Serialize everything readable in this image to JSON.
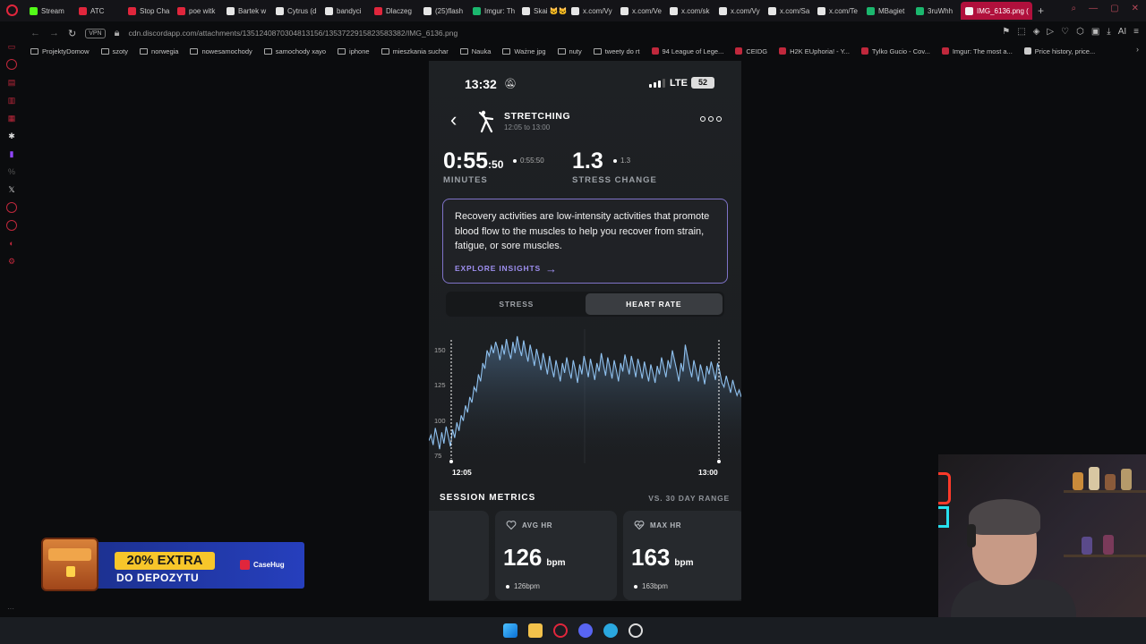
{
  "browser": {
    "tabs": [
      {
        "label": "Stream",
        "color": "#53fc18"
      },
      {
        "label": "ATC",
        "color": "#e0263c"
      },
      {
        "label": "Stop Cha",
        "color": "#e0263c"
      },
      {
        "label": "poe witk",
        "color": "#e0263c"
      },
      {
        "label": "Bartek w",
        "color": "#e6e6e6"
      },
      {
        "label": "Cytrus (d",
        "color": "#e6e6e6"
      },
      {
        "label": "bandyci",
        "color": "#e6e6e6"
      },
      {
        "label": "Dlaczeg",
        "color": "#e0263c"
      },
      {
        "label": "(25)flash",
        "color": "#e6e6e6"
      },
      {
        "label": "Imgur: Th",
        "color": "#1bb76e"
      },
      {
        "label": "Skai 🐱🐱",
        "color": "#e6e6e6"
      },
      {
        "label": "x.com/Vy",
        "color": "#e6e6e6"
      },
      {
        "label": "x.com/Ve",
        "color": "#e6e6e6"
      },
      {
        "label": "x.com/sk",
        "color": "#e6e6e6"
      },
      {
        "label": "x.com/Vy",
        "color": "#e6e6e6"
      },
      {
        "label": "x.com/Sa",
        "color": "#e6e6e6"
      },
      {
        "label": "x.com/Te",
        "color": "#e6e6e6"
      },
      {
        "label": "MBagiet",
        "color": "#1bb76e"
      },
      {
        "label": "3ruWhh",
        "color": "#1bb76e"
      }
    ],
    "active_tab": "IMG_6136.png (",
    "new_tab": "+",
    "vpn": "VPN",
    "url": "cdn.discordapp.com/attachments/1351240870304813156/1353722915823583382/IMG_6136.png",
    "ai_label": "AI",
    "bookmarks": [
      {
        "label": "ProjektyDomow",
        "type": "folder"
      },
      {
        "label": "szoty",
        "type": "folder"
      },
      {
        "label": "norwegia",
        "type": "folder"
      },
      {
        "label": "nowesamochody",
        "type": "folder"
      },
      {
        "label": "samochody xayo",
        "type": "folder"
      },
      {
        "label": "iphone",
        "type": "folder"
      },
      {
        "label": "mieszkania suchar",
        "type": "folder"
      },
      {
        "label": "Nauka",
        "type": "folder"
      },
      {
        "label": "Ważne jpg",
        "type": "folder"
      },
      {
        "label": "nuty",
        "type": "folder"
      },
      {
        "label": "tweety do rt",
        "type": "folder"
      },
      {
        "label": "94 League of Lege...",
        "type": "site"
      },
      {
        "label": "CEIDG",
        "type": "site"
      },
      {
        "label": "H2K EUphoria! - Y...",
        "type": "site"
      },
      {
        "label": "Tylko Gucio - Cov...",
        "type": "site"
      },
      {
        "label": "Imgur: The most a...",
        "type": "site"
      },
      {
        "label": "Price history, price...",
        "type": "page"
      }
    ]
  },
  "phone": {
    "status": {
      "time": "13:32",
      "network": "LTE",
      "battery": "52"
    },
    "activity": {
      "title": "STRETCHING",
      "time_range": "12:05 to 13:00"
    },
    "duration": {
      "main": "0:55",
      "seconds": ":50",
      "compare": "0:55:50",
      "label": "MINUTES"
    },
    "stress": {
      "value": "1.3",
      "compare": "1.3",
      "label": "STRESS CHANGE"
    },
    "insight": {
      "text": "Recovery activities are low-intensity activities that promote blood flow to the muscles to help you recover from strain, fatigue, or sore muscles.",
      "link": "EXPLORE INSIGHTS"
    },
    "toggle": {
      "left": "STRESS",
      "right": "HEART RATE",
      "active": "right"
    },
    "metrics": {
      "title": "SESSION METRICS",
      "range_label": "VS. 30 DAY RANGE",
      "cards": [
        {
          "title": "AVG HR",
          "value": "126",
          "unit": "bpm",
          "range": "126bpm"
        },
        {
          "title": "MAX HR",
          "value": "163",
          "unit": "bpm",
          "range": "163bpm"
        }
      ]
    }
  },
  "chart_data": {
    "type": "line",
    "y_ticks": [
      "150",
      "125",
      "100",
      "75"
    ],
    "x_ticks": [
      "12:05",
      "13:00"
    ],
    "ylim": [
      70,
      165
    ],
    "line_color": "#8fc1ef",
    "series": [
      {
        "values": [
          86,
          90,
          83,
          95,
          88,
          80,
          92,
          84,
          96,
          89,
          82,
          94,
          88,
          99,
          93,
          104,
          100,
          111,
          106,
          117,
          113,
          124,
          121,
          133,
          128,
          141,
          137,
          150,
          146,
          153,
          148,
          156,
          151,
          143,
          154,
          147,
          158,
          150,
          144,
          156,
          148,
          160,
          152,
          146,
          157,
          149,
          142,
          154,
          147,
          139,
          151,
          144,
          136,
          148,
          141,
          133,
          146,
          138,
          131,
          143,
          136,
          128,
          141,
          134,
          145,
          137,
          130,
          143,
          136,
          127,
          140,
          133,
          146,
          139,
          131,
          144,
          137,
          129,
          141,
          135,
          148,
          140,
          132,
          145,
          138,
          130,
          143,
          136,
          128,
          141,
          135,
          147,
          140,
          133,
          146,
          139,
          131,
          144,
          138,
          130,
          142,
          135,
          128,
          140,
          134,
          127,
          139,
          133,
          145,
          138,
          131,
          143,
          137,
          150,
          143,
          136,
          128,
          141,
          135,
          154,
          146,
          138,
          131,
          143,
          136,
          128,
          140,
          134,
          126,
          139,
          133,
          142,
          136,
          129,
          141,
          135,
          127,
          124,
          132,
          126,
          120,
          129,
          123,
          118,
          122,
          117
        ]
      }
    ]
  },
  "ad": {
    "badge": "20% EXTRA",
    "subtitle": "DO DEPOZYTU",
    "brand": "CaseHug"
  }
}
